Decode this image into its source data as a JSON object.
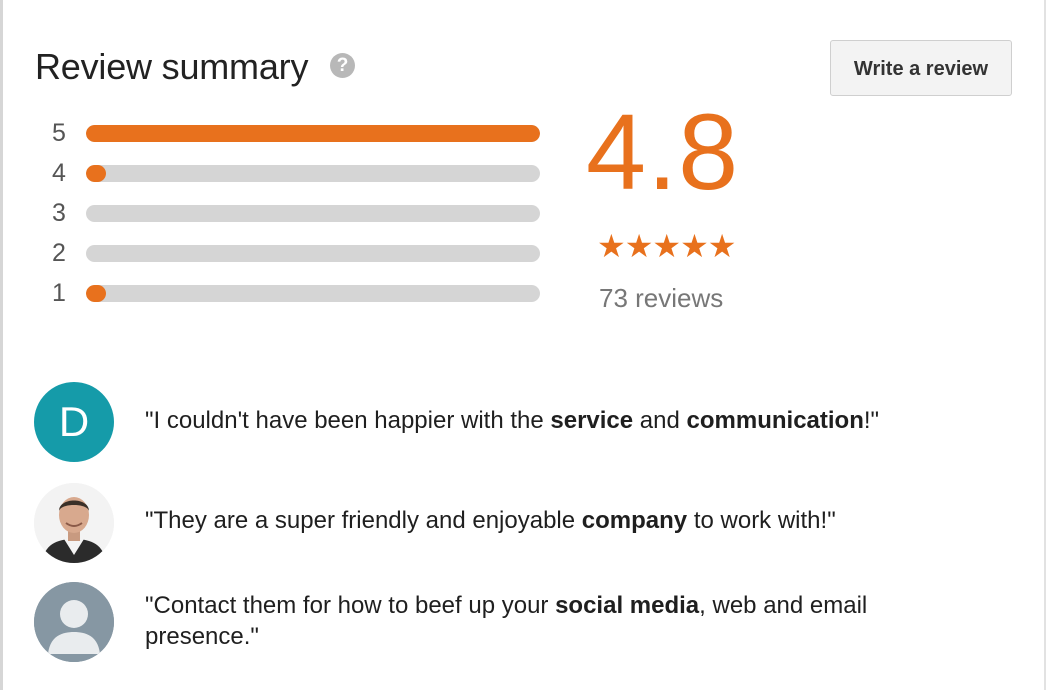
{
  "header": {
    "title": "Review summary",
    "help_icon": "question-mark-circle-icon",
    "write_review_label": "Write a review"
  },
  "histogram": [
    {
      "label": "5",
      "fraction": 1.0
    },
    {
      "label": "4",
      "fraction": 0.04
    },
    {
      "label": "3",
      "fraction": 0.0
    },
    {
      "label": "2",
      "fraction": 0.0
    },
    {
      "label": "1",
      "fraction": 0.04
    }
  ],
  "rating": {
    "score": "4.8",
    "stars": "★★★★★",
    "review_count": "73 reviews"
  },
  "reviews": [
    {
      "avatar_type": "letter",
      "avatar_letter": "D",
      "avatar_color": "#159ba9",
      "parts": [
        {
          "text": "\"I couldn't have been happier with the ",
          "bold": false
        },
        {
          "text": "service",
          "bold": true
        },
        {
          "text": " and ",
          "bold": false
        },
        {
          "text": "communication",
          "bold": true
        },
        {
          "text": "!\"",
          "bold": false
        }
      ]
    },
    {
      "avatar_type": "photo",
      "avatar_icon": "user-photo-icon",
      "parts": [
        {
          "text": "\"They are a super friendly and enjoyable ",
          "bold": false
        },
        {
          "text": "company",
          "bold": true
        },
        {
          "text": " to work with!\"",
          "bold": false
        }
      ]
    },
    {
      "avatar_type": "default",
      "avatar_icon": "default-user-icon",
      "parts": [
        {
          "text": "\"Contact them for how to beef up your ",
          "bold": false
        },
        {
          "text": "social media",
          "bold": true
        },
        {
          "text": ", web and email presence.\"",
          "bold": false
        }
      ]
    }
  ],
  "colors": {
    "accent": "#e8711d",
    "track": "#d5d5d5",
    "text": "#222222",
    "muted": "#777777"
  }
}
